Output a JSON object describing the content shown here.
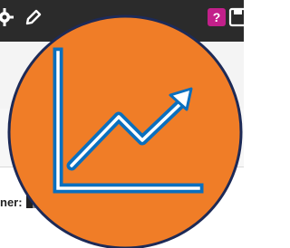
{
  "toolbar": {
    "icons": [
      "gear-icon",
      "pencil-icon",
      "help-icon",
      "save-icon"
    ],
    "help_color": "#c2208a"
  },
  "owner": {
    "label": "ner:"
  },
  "logo": {
    "icon": "trending-up-chart-icon",
    "fill_color": "#f07d27",
    "outline_color": "#1d2a57",
    "stroke_color": "#0a6fbe"
  }
}
